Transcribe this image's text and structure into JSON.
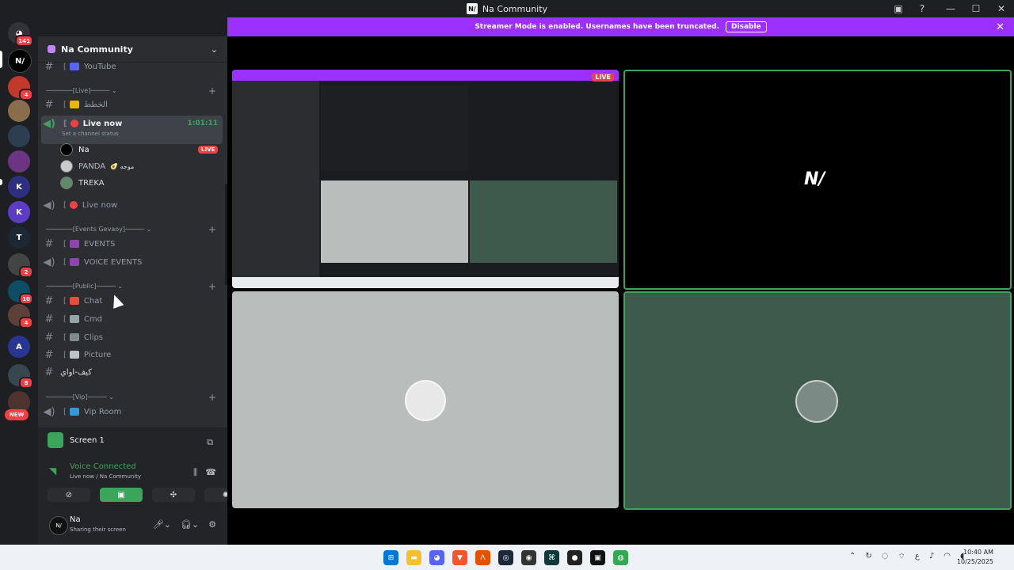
{
  "window": {
    "title": "Na Community",
    "logo_text": "N/"
  },
  "rail": {
    "home_badge": "141",
    "servers": [
      {
        "badge": ""
      },
      {
        "badge": "4"
      },
      {
        "badge": ""
      },
      {
        "badge": ""
      },
      {
        "badge": ""
      },
      {
        "badge": ""
      },
      {
        "badge": ""
      },
      {
        "badge": ""
      },
      {
        "badge": "2"
      },
      {
        "badge": "10"
      },
      {
        "badge": "4"
      },
      {
        "badge": ""
      },
      {
        "badge": "8"
      }
    ],
    "new_label": "NEW"
  },
  "sidebar": {
    "guild_name": "Na Community",
    "channels": {
      "youtube": "YouTube",
      "cat_live": "Live",
      "khat": "الخطط",
      "live_now": "Live now",
      "live_timer": "1:01:11",
      "set_status": "Set a channel status",
      "live_now_2": "Live now",
      "cat_events": "Events Gevaoy",
      "events": "EVENTS",
      "voice_events": "VOICE EVENTS",
      "cat_public": "Public",
      "chat": "Chat",
      "cmd": "Cmd",
      "clips": "Clips",
      "picture": "Picture",
      "kif": "كيف-اواي",
      "cat_vip": "Vip",
      "vip_room": "Vip Room"
    },
    "voice_users": [
      {
        "name": "Na",
        "badge": "LIVE"
      },
      {
        "name": "PANDA",
        "extra": "🥑 موجه"
      },
      {
        "name": "TREKA"
      }
    ]
  },
  "panel": {
    "screen_label": "Screen 1",
    "voice_connected": "Voice Connected",
    "voice_location": "Live now / Na Community",
    "user_name": "Na",
    "user_status": "Sharing their screen"
  },
  "banner": {
    "text": "Streamer Mode is enabled. Usernames have been truncated.",
    "button": "Disable"
  },
  "stage": {
    "live_badge": "LIVE",
    "logo_text": "N/"
  },
  "taskbar": {
    "time": "10:40 AM",
    "date": "10/25/2025"
  },
  "colors": {
    "accent": "#9b30ff",
    "voice_green": "#3ba55c",
    "live_red": "#ed4245"
  }
}
